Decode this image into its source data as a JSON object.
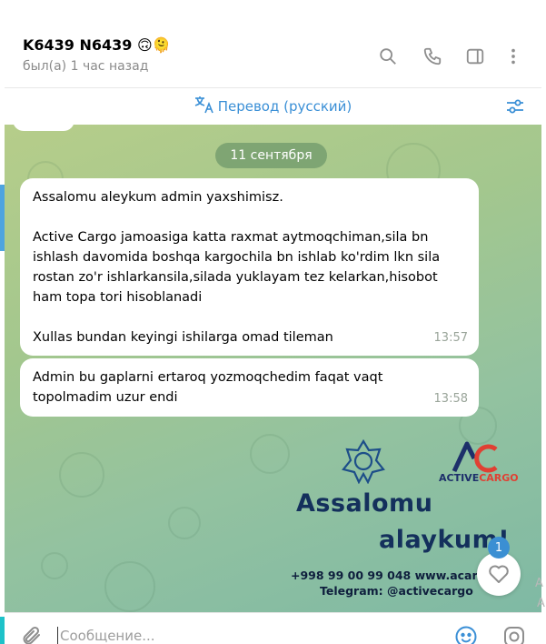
{
  "header": {
    "chat_name": "K6439 N6439 🙃🫠",
    "status": "был(а) 1 час назад",
    "icons": [
      "search-icon",
      "phone-icon",
      "sidebar-toggle-icon",
      "more-vertical-icon"
    ]
  },
  "translate": {
    "label": "Перевод (русский)",
    "icon": "translate-icon",
    "settings_icon": "filter-settings-icon"
  },
  "chat": {
    "date_separator": "11 сентября",
    "messages": [
      {
        "lines": [
          "Assalomu aleykum admin yaxshimisz.",
          "",
          "Active Cargo jamoasiga katta raxmat aytmoqchiman,sila bn",
          "ishlash davomida boshqa kargochila bn ishlab ko'rdim lkn sila",
          "rostan zo'r ishlarkansila,silada yuklayam tez kelarkan,hisobot",
          "ham topa tori hisoblanadi",
          "",
          "Xullas bundan keyingi ishilarga omad tileman"
        ],
        "time": "13:57"
      },
      {
        "lines": [
          "Admin bu gaplarni ertaroq yozmoqchedim faqat vaqt",
          "topolmadim uzur endi"
        ],
        "time": "13:58"
      }
    ],
    "banner": {
      "brand_part1": "ACTIVE",
      "brand_part2": "CARGO",
      "title_line1": "Assalomu",
      "title_line2": "alaykum!",
      "phone": "+998 99 00 99 048  www.acarg",
      "telegram": "Telegram: @activecargo",
      "brand_colors": {
        "navy": "#14305c",
        "red": "#e04033"
      }
    },
    "reaction": {
      "icon": "heart-icon",
      "count": "1"
    }
  },
  "input": {
    "placeholder": "Сообщение...",
    "value": ""
  },
  "edge_text": {
    "letter1": "A",
    "letter2": "A"
  },
  "colors": {
    "accent": "#3a8fd6",
    "badge": "#3b8fd3",
    "date_pill": "#5a875f"
  }
}
